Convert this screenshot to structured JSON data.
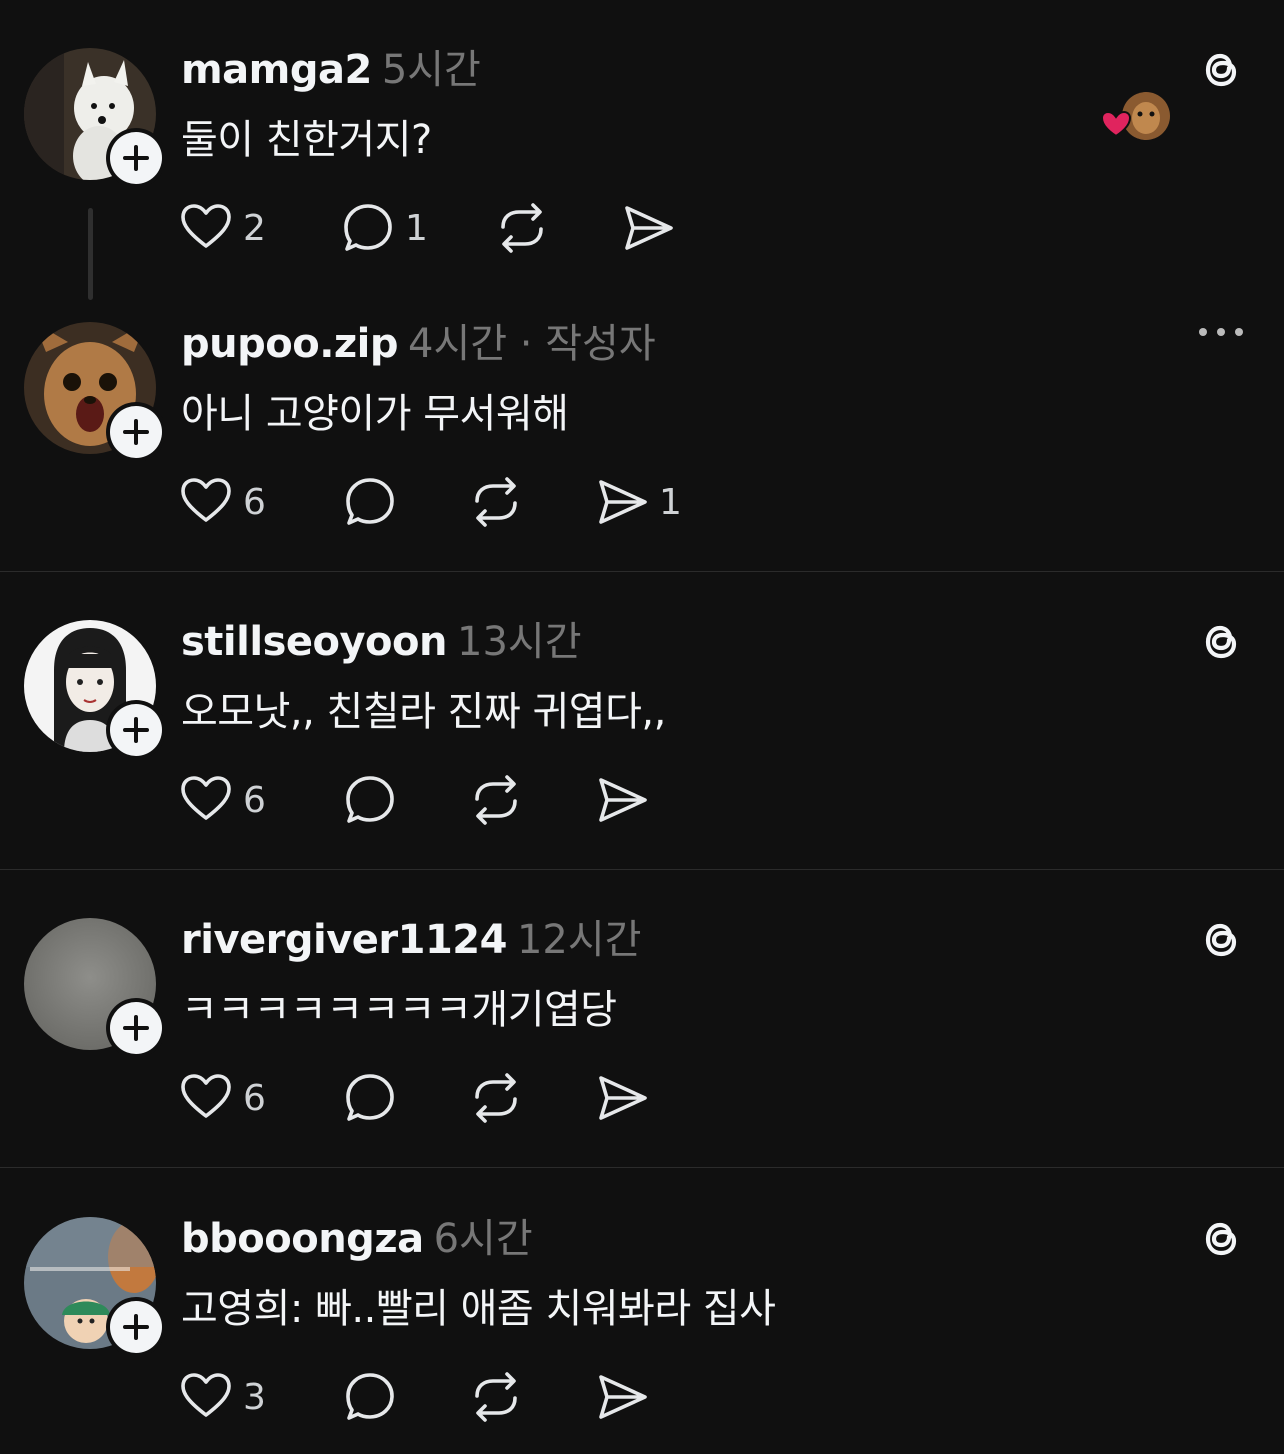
{
  "colors": {
    "background": "#101010",
    "text": "#f3f5f7",
    "meta": "#777777",
    "heart_liked": "#e0245e"
  },
  "posts": [
    {
      "username": "mamga2",
      "time": "5시간",
      "author_tag": "",
      "text": "둘이 친한거지?",
      "likes": "2",
      "replies": "1",
      "reposts": "",
      "shares": "",
      "corner_icon": "threads-icon",
      "avatar": "white-dog"
    },
    {
      "username": "pupoo.zip",
      "time": "4시간",
      "author_tag": " · 작성자",
      "text": "아니 고양이가 무서워해",
      "likes": "6",
      "replies": "",
      "reposts": "",
      "shares": "1",
      "corner_icon": "more-icon",
      "avatar": "brown-chihuahua"
    },
    {
      "username": "stillseoyoon",
      "time": "13시간",
      "author_tag": "",
      "text": "오모낫,, 친칠라 진짜 귀엽다,,",
      "likes": "6",
      "replies": "",
      "reposts": "",
      "shares": "",
      "corner_icon": "threads-icon",
      "avatar": "illustrated-girl"
    },
    {
      "username": "rivergiver1124",
      "time": "12시간",
      "author_tag": "",
      "text": "ㅋㅋㅋㅋㅋㅋㅋㅋ개기엽당",
      "likes": "6",
      "replies": "",
      "reposts": "",
      "shares": "",
      "corner_icon": "threads-icon",
      "avatar": "blurred-gray"
    },
    {
      "username": "bbooongza",
      "time": "6시간",
      "author_tag": "",
      "text": "고영희: 빠..빨리 애좀 치워봐라 집사",
      "likes": "3",
      "replies": "",
      "reposts": "",
      "shares": "",
      "corner_icon": "threads-icon",
      "avatar": "baby-photo"
    }
  ]
}
